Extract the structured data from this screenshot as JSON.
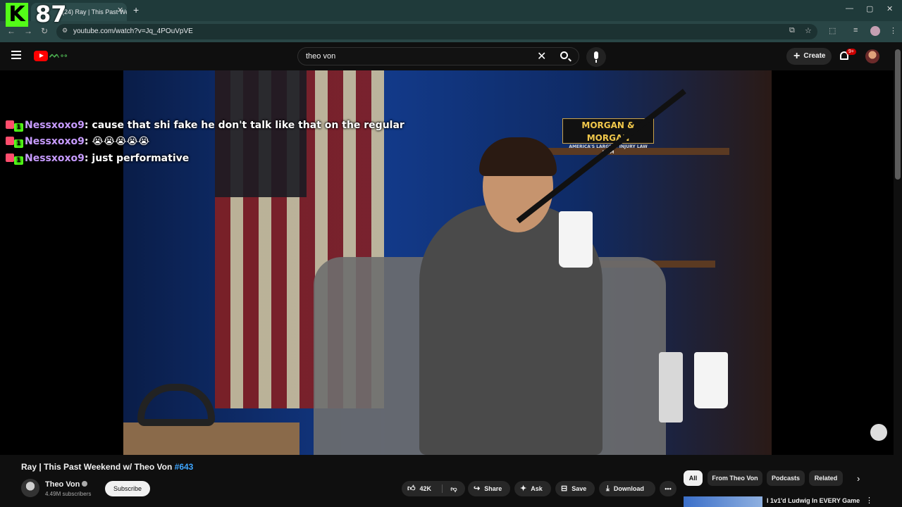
{
  "overlay": {
    "viewer_count": "87",
    "logo_letter": "K"
  },
  "browser": {
    "tab_title": "(24) Ray | This Past Weekend w/",
    "url": "youtube.com/watch?v=Jq_4POuVpVE"
  },
  "youtube": {
    "search_value": "theo von",
    "create_label": "Create",
    "notification_badge": "9+"
  },
  "video": {
    "sign_title": "MORGAN & MORGAN",
    "sign_subtitle": "AMERICA'S LARGEST INJURY LAW FIRM"
  },
  "chat": [
    {
      "user": "Nessxoxo9",
      "message": ": cause that shi fake he don't talk like that on the regular"
    },
    {
      "user": "Nessxoxo9",
      "message": ": 😭😭😭😭😭"
    },
    {
      "user": "Nessxoxo9",
      "message": ": just performative"
    }
  ],
  "watch": {
    "title": "Ray | This Past Weekend w/ Theo Von ",
    "hashtag": "#643",
    "channel_name": "Theo Von",
    "subscribers": "4.49M subscribers",
    "subscribe_label": "Subscribe",
    "likes": "42K",
    "share_label": "Share",
    "ask_label": "Ask",
    "save_label": "Save",
    "download_label": "Download"
  },
  "chips": [
    "All",
    "From Theo Von",
    "Podcasts",
    "Related"
  ],
  "recommendation": {
    "title": "I 1v1'd Ludwig In EVERY Game"
  },
  "icons": [
    "menu-icon",
    "youtube-logo",
    "search-icon",
    "clear-icon",
    "mic-icon",
    "plus-icon",
    "bell-icon",
    "like-icon",
    "dislike-icon",
    "share-icon",
    "sparkle-icon",
    "save-icon",
    "download-icon",
    "more-icon",
    "chevron-right-icon"
  ],
  "colors": {
    "accent": "#ff0000",
    "kick_green": "#53fc18",
    "link": "#3ea6ff",
    "chat_user": "#c79bff"
  }
}
